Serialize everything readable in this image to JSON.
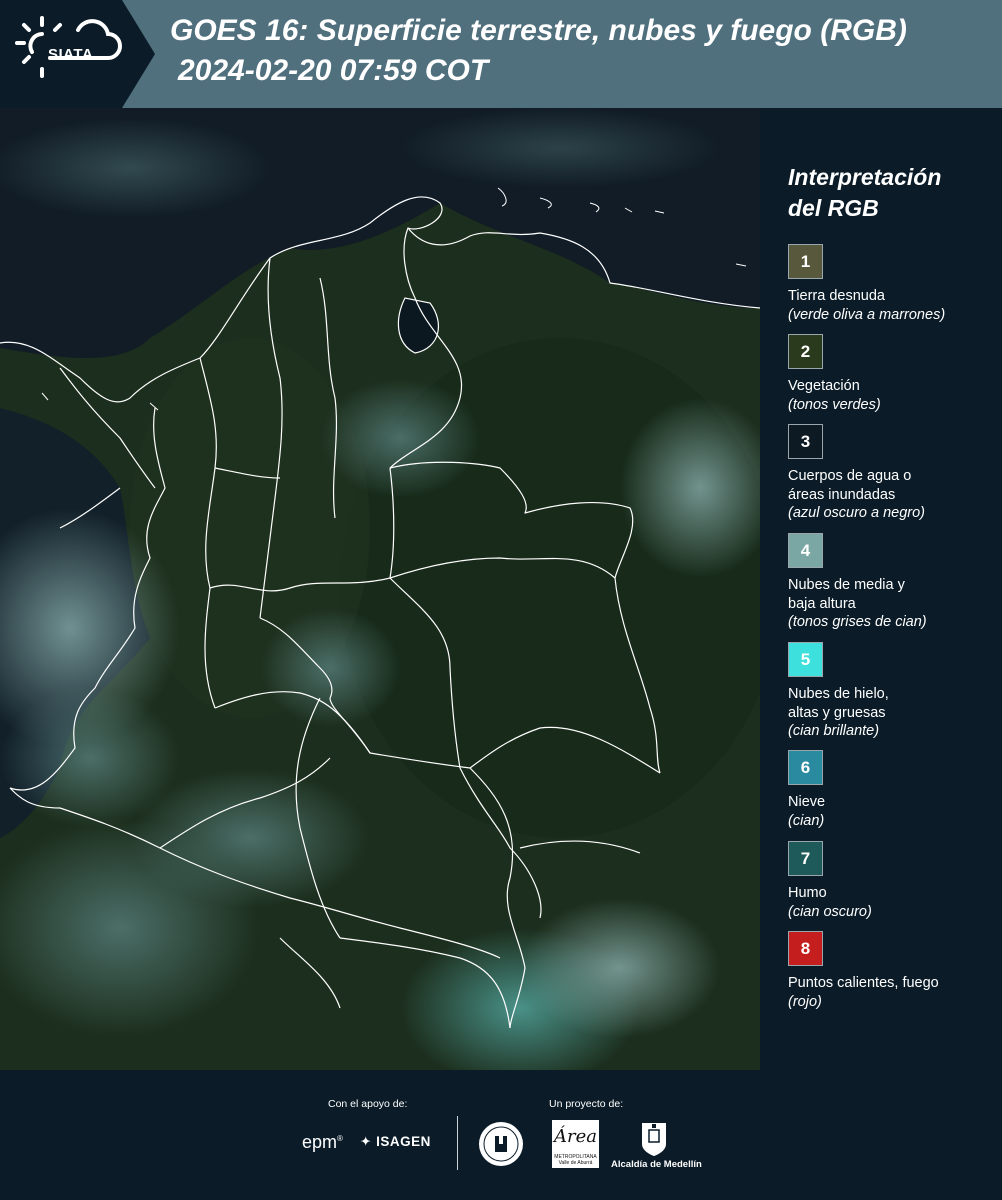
{
  "header": {
    "logo_text": "SIATA",
    "title_line1": "GOES 16: Superficie terrestre, nubes y fuego (RGB)",
    "title_line2": "2024-02-20 07:59 COT",
    "bg_color": "#50707e"
  },
  "legend": {
    "title_line1": "Interpretación",
    "title_line2": "del RGB",
    "items": [
      {
        "number": "1",
        "label": "Tierra desnuda",
        "sub": "(verde oliva a marrones)",
        "color": "#58583c"
      },
      {
        "number": "2",
        "label": "Vegetación",
        "sub": "(tonos verdes)",
        "color": "#2a3a1c"
      },
      {
        "number": "3",
        "label": "Cuerpos de agua o",
        "label2": "áreas inundadas",
        "sub": "(azul oscuro a negro)",
        "color": "#0d1a24"
      },
      {
        "number": "4",
        "label": "Nubes de media y",
        "label2": "baja altura",
        "sub": "(tonos grises de cian)",
        "color": "#7aa6a4"
      },
      {
        "number": "5",
        "label": "Nubes de hielo,",
        "label2": "altas y gruesas",
        "sub": "(cian brillante)",
        "color": "#3ee0de"
      },
      {
        "number": "6",
        "label": "Nieve",
        "sub": "(cian)",
        "color": "#2a8aa0"
      },
      {
        "number": "7",
        "label": "Humo",
        "sub": "(cian oscuro)",
        "color": "#1f5a5a"
      },
      {
        "number": "8",
        "label": "Puntos calientes, fuego",
        "sub": "(rojo)",
        "color": "#c41e1e"
      }
    ]
  },
  "footer": {
    "support_label": "Con el apoyo de:",
    "project_label": "Un proyecto de:",
    "epm": "epm",
    "isagen": "ISAGEN",
    "metro_title": "Área",
    "metro_caption": "METROPOLITANA Valle de Aburrá",
    "alcaldia": "Alcaldía de Medellín"
  }
}
